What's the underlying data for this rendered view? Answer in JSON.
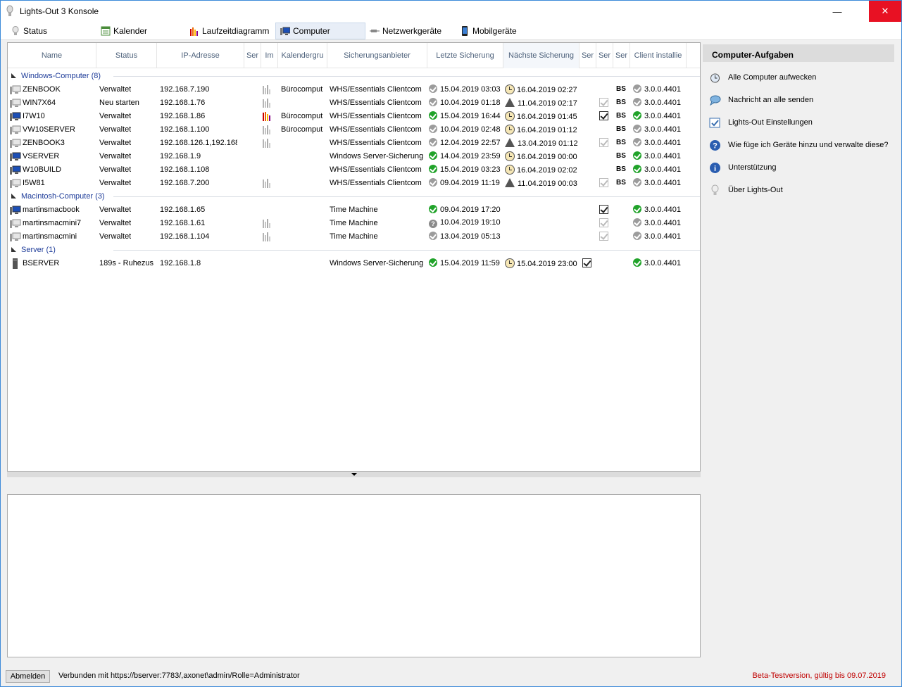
{
  "window": {
    "title": "Lights-Out 3 Konsole",
    "minimize": "—",
    "maximize": "☐",
    "close": "✕"
  },
  "tabs": [
    {
      "label": "Status",
      "icon": "lightbulb-icon"
    },
    {
      "label": "Kalender",
      "icon": "calendar-icon"
    },
    {
      "label": "Laufzeitdiagramm",
      "icon": "bar-chart-icon"
    },
    {
      "label": "Computer",
      "icon": "computer-icon"
    },
    {
      "label": "Netzwerkgeräte",
      "icon": "network-cable-icon"
    },
    {
      "label": "Mobilgeräte",
      "icon": "smartphone-icon"
    }
  ],
  "columns": [
    "Name",
    "Status",
    "IP-Adresse",
    "Ser",
    "Im",
    "Kalendergru",
    "Sicherungsanbieter",
    "Letzte Sicherung",
    "Nächste Sicherung",
    "Ser",
    "Ser",
    "Ser",
    "Client installie"
  ],
  "groups": [
    {
      "label": "Windows-Computer (8)",
      "rows": [
        {
          "name": "ZENBOOK",
          "status": "Verwaltet",
          "ip": "192.168.7.190",
          "chart": "gray",
          "kal": "Bürocomput",
          "prov": "WHS/Essentials Clientcom",
          "last": "15.04.2019 03:03",
          "last_icon": "check-gray",
          "next": "16.04.2019 02:27",
          "next_icon": "clock",
          "chk": "",
          "bs": "BS",
          "client": "3.0.0.4401",
          "client_icon": "check-gray",
          "pc": "gray"
        },
        {
          "name": "WIN7X64",
          "status": "Neu starten",
          "ip": "192.168.1.76",
          "chart": "gray",
          "kal": "",
          "prov": "WHS/Essentials Clientcom",
          "last": "10.04.2019 01:18",
          "last_icon": "check-gray",
          "next": "11.04.2019 02:17",
          "next_icon": "warning",
          "chk": "dim",
          "bs": "BS",
          "client": "3.0.0.4401",
          "client_icon": "check-gray",
          "pc": "gray"
        },
        {
          "name": "I7W10",
          "status": "Verwaltet",
          "ip": "192.168.1.86",
          "chart": "color",
          "kal": "Bürocomput",
          "prov": "WHS/Essentials Clientcom",
          "last": "15.04.2019 16:44",
          "last_icon": "check-green",
          "next": "16.04.2019 01:45",
          "next_icon": "clock",
          "chk": "on",
          "bs": "BS",
          "client": "3.0.0.4401",
          "client_icon": "check-green",
          "pc": "blue"
        },
        {
          "name": "VW10SERVER",
          "status": "Verwaltet",
          "ip": "192.168.1.100",
          "chart": "gray",
          "kal": "Bürocomput",
          "prov": "WHS/Essentials Clientcom",
          "last": "10.04.2019 02:48",
          "last_icon": "check-gray",
          "next": "16.04.2019 01:12",
          "next_icon": "clock",
          "chk": "",
          "bs": "BS",
          "client": "3.0.0.4401",
          "client_icon": "check-gray",
          "pc": "gray"
        },
        {
          "name": "ZENBOOK3",
          "status": "Verwaltet",
          "ip": "192.168.126.1,192.168.",
          "chart": "gray",
          "kal": "",
          "prov": "WHS/Essentials Clientcom",
          "last": "12.04.2019 22:57",
          "last_icon": "check-gray",
          "next": "13.04.2019 01:12",
          "next_icon": "warning",
          "chk": "dim",
          "bs": "BS",
          "client": "3.0.0.4401",
          "client_icon": "check-gray",
          "pc": "gray"
        },
        {
          "name": "VSERVER",
          "status": "Verwaltet",
          "ip": "192.168.1.9",
          "chart": "",
          "kal": "",
          "prov": "Windows Server-Sicherung",
          "last": "14.04.2019 23:59",
          "last_icon": "check-green",
          "next": "16.04.2019 00:00",
          "next_icon": "clock",
          "chk": "",
          "bs": "BS",
          "client": "3.0.0.4401",
          "client_icon": "check-green",
          "pc": "blue"
        },
        {
          "name": "W10BUILD",
          "status": "Verwaltet",
          "ip": "192.168.1.108",
          "chart": "",
          "kal": "",
          "prov": "WHS/Essentials Clientcom",
          "last": "15.04.2019 03:23",
          "last_icon": "check-green",
          "next": "16.04.2019 02:02",
          "next_icon": "clock",
          "chk": "",
          "bs": "BS",
          "client": "3.0.0.4401",
          "client_icon": "check-green",
          "pc": "blue"
        },
        {
          "name": "I5W81",
          "status": "Verwaltet",
          "ip": "192.168.7.200",
          "chart": "gray",
          "kal": "",
          "prov": "WHS/Essentials Clientcom",
          "last": "09.04.2019 11:19",
          "last_icon": "check-gray",
          "next": "11.04.2019 00:03",
          "next_icon": "warning",
          "chk": "dim",
          "bs": "BS",
          "client": "3.0.0.4401",
          "client_icon": "check-gray",
          "pc": "gray"
        }
      ]
    },
    {
      "label": "Macintosh-Computer (3)",
      "rows": [
        {
          "name": "martinsmacbook",
          "status": "Verwaltet",
          "ip": "192.168.1.65",
          "chart": "",
          "kal": "",
          "prov": "Time Machine",
          "last": "09.04.2019 17:20",
          "last_icon": "check-green",
          "next": "",
          "next_icon": "",
          "chk": "on",
          "bs": "",
          "client": "3.0.0.4401",
          "client_icon": "check-green",
          "pc": "blue"
        },
        {
          "name": "martinsmacmini7",
          "status": "Verwaltet",
          "ip": "192.168.1.61",
          "chart": "gray",
          "kal": "",
          "prov": "Time Machine",
          "last": "10.04.2019 19:10",
          "last_icon": "question",
          "next": "",
          "next_icon": "",
          "chk": "dim",
          "bs": "",
          "client": "3.0.0.4401",
          "client_icon": "check-gray",
          "pc": "gray"
        },
        {
          "name": "martinsmacmini",
          "status": "Verwaltet",
          "ip": "192.168.1.104",
          "chart": "gray",
          "kal": "",
          "prov": "Time Machine",
          "last": "13.04.2019 05:13",
          "last_icon": "check-gray",
          "next": "",
          "next_icon": "",
          "chk": "dim",
          "bs": "",
          "client": "3.0.0.4401",
          "client_icon": "check-gray",
          "pc": "gray"
        }
      ]
    },
    {
      "label": "Server (1)",
      "rows": [
        {
          "name": "BSERVER",
          "status": "189s - Ruhezus",
          "ip": "192.168.1.8",
          "chart": "",
          "kal": "",
          "prov": "Windows Server-Sicherung",
          "last": "15.04.2019 11:59",
          "last_icon": "check-green",
          "next": "15.04.2019 23:00",
          "next_icon": "clock",
          "chk": "on-left",
          "bs": "",
          "client": "3.0.0.4401",
          "client_icon": "check-green",
          "pc": "server"
        }
      ]
    }
  ],
  "sidebar": {
    "title": "Computer-Aufgaben",
    "tasks": [
      {
        "label": "Alle Computer aufwecken",
        "icon": "alarm-clock-icon"
      },
      {
        "label": "Nachricht an alle senden",
        "icon": "speech-bubble-icon"
      },
      {
        "label": "Lights-Out Einstellungen",
        "icon": "settings-checkbox-icon"
      },
      {
        "label": "Wie füge ich Geräte hinzu und verwalte diese?",
        "icon": "help-icon"
      },
      {
        "label": "Unterstützung",
        "icon": "info-icon"
      },
      {
        "label": "Über Lights-Out",
        "icon": "lightbulb-icon"
      }
    ]
  },
  "statusbar": {
    "logout": "Abmelden",
    "connection": "Verbunden  mit  https://bserver:7783/,axonet\\admin/Rolle=Administrator",
    "beta": "Beta-Testversion,  gültig bis 09.07.2019"
  },
  "colors": {
    "accent": "#3c8ad9",
    "close": "#e81123",
    "ok_green": "#21a32a",
    "group_text": "#1e3c99",
    "beta_text": "#c00000"
  }
}
